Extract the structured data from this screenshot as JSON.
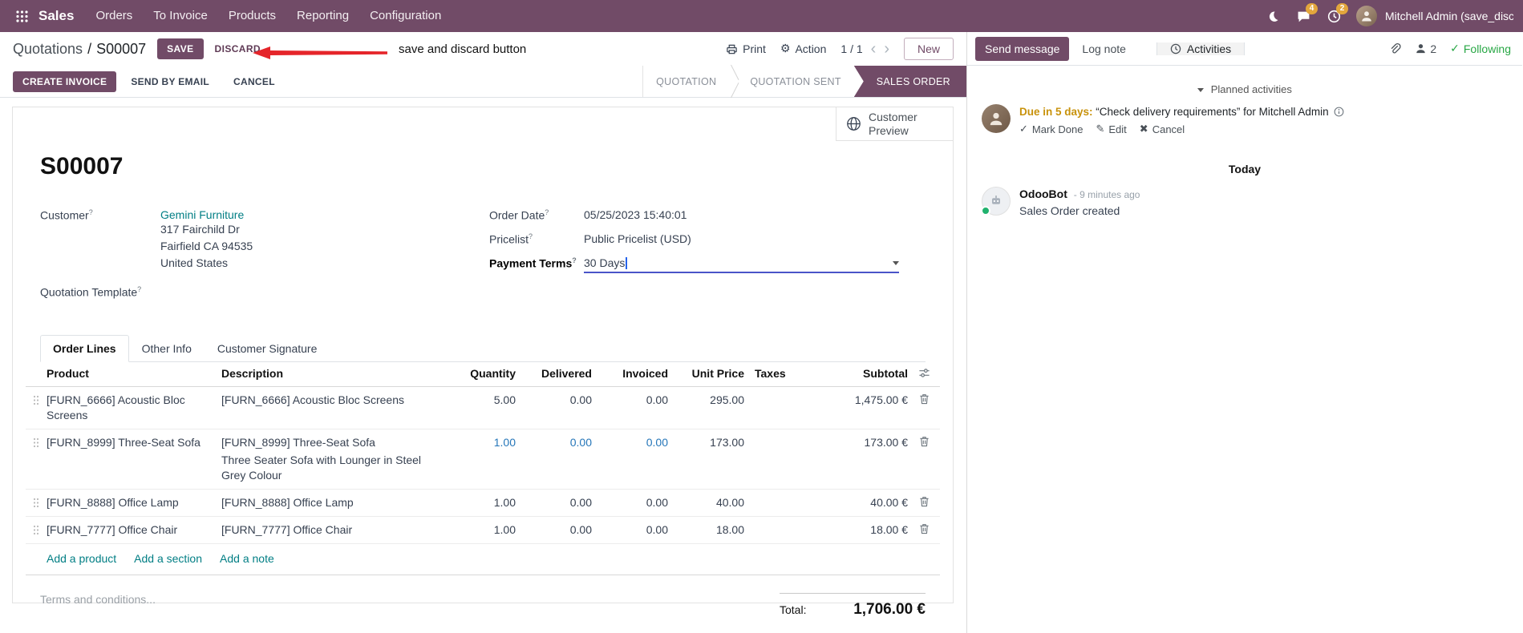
{
  "navbar": {
    "brand": "Sales",
    "items": [
      "Orders",
      "To Invoice",
      "Products",
      "Reporting",
      "Configuration"
    ],
    "message_badge": "4",
    "activity_badge": "2",
    "user": "Mitchell Admin (save_discar"
  },
  "breadcrumb": {
    "parent": "Quotations",
    "separator": "/",
    "current": "S00007",
    "save": "SAVE",
    "discard": "DISCARD",
    "print": "Print",
    "action": "Action",
    "pager": "1 / 1",
    "new": "New"
  },
  "annotation": {
    "text": "save and discard button"
  },
  "statusbar": {
    "buttons": [
      "CREATE INVOICE",
      "SEND BY EMAIL",
      "CANCEL"
    ],
    "states": [
      "QUOTATION",
      "QUOTATION SENT",
      "SALES ORDER"
    ],
    "active_state": "SALES ORDER"
  },
  "sheet": {
    "customer_preview": "Customer Preview",
    "title": "S00007",
    "field_hint": "?",
    "fields": {
      "customer_label": "Customer",
      "customer_name": "Gemini Furniture",
      "address_line1": "317 Fairchild Dr",
      "address_line2": "Fairfield CA 94535",
      "address_line3": "United States",
      "quotation_template_label": "Quotation Template",
      "order_date_label": "Order Date",
      "order_date": "05/25/2023 15:40:01",
      "pricelist_label": "Pricelist",
      "pricelist": "Public Pricelist (USD)",
      "payment_terms_label": "Payment Terms",
      "payment_terms": "30 Days"
    },
    "tabs": [
      "Order Lines",
      "Other Info",
      "Customer Signature"
    ],
    "active_tab": "Order Lines",
    "table": {
      "columns": [
        "Product",
        "Description",
        "Quantity",
        "Delivered",
        "Invoiced",
        "Unit Price",
        "Taxes",
        "Subtotal"
      ],
      "rows": [
        {
          "product": "[FURN_6666] Acoustic Bloc Screens",
          "description": "[FURN_6666] Acoustic Bloc Screens",
          "description2": "",
          "quantity": "5.00",
          "delivered": "0.00",
          "invoiced": "0.00",
          "unit_price": "295.00",
          "taxes": "",
          "subtotal": "1,475.00 €"
        },
        {
          "product": "[FURN_8999] Three-Seat Sofa",
          "description": "[FURN_8999] Three-Seat Sofa",
          "description2": "Three Seater Sofa with Lounger in Steel Grey Colour",
          "quantity": "1.00",
          "delivered": "0.00",
          "invoiced": "0.00",
          "unit_price": "173.00",
          "taxes": "",
          "subtotal": "173.00 €"
        },
        {
          "product": "[FURN_8888] Office Lamp",
          "description": "[FURN_8888] Office Lamp",
          "description2": "",
          "quantity": "1.00",
          "delivered": "0.00",
          "invoiced": "0.00",
          "unit_price": "40.00",
          "taxes": "",
          "subtotal": "40.00 €"
        },
        {
          "product": "[FURN_7777] Office Chair",
          "description": "[FURN_7777] Office Chair",
          "description2": "",
          "quantity": "1.00",
          "delivered": "0.00",
          "invoiced": "0.00",
          "unit_price": "18.00",
          "taxes": "",
          "subtotal": "18.00 €"
        }
      ],
      "footer_links": [
        "Add a product",
        "Add a section",
        "Add a note"
      ]
    },
    "terms_placeholder": "Terms and conditions...",
    "total_label": "Total:",
    "total_value": "1,706.00 €"
  },
  "chatter": {
    "send_message": "Send message",
    "log_note": "Log note",
    "activities": "Activities",
    "followers_count": "2",
    "following": "Following",
    "planned_activities": "Planned activities",
    "activity": {
      "due": "Due in 5 days:",
      "summary": "“Check delivery requirements”",
      "for_text": "for Mitchell Admin",
      "mark_done": "Mark Done",
      "edit": "Edit",
      "cancel": "Cancel"
    },
    "today": "Today",
    "message": {
      "author": "OdooBot",
      "time": "- 9 minutes ago",
      "body": "Sales Order created"
    }
  },
  "colors": {
    "accent": "#714B67",
    "link_teal": "#017E84",
    "edited_blue": "#2576b9",
    "due_warning": "#C8920B",
    "arrow_red": "#E5252A",
    "following_green": "#28a745",
    "badge_amber": "#E3A63C"
  }
}
